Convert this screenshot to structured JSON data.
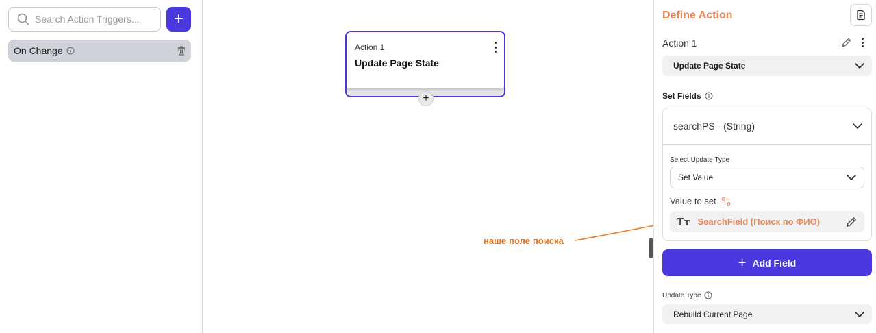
{
  "left_panel": {
    "search_placeholder": "Search Action Triggers...",
    "add_label": "+",
    "triggers": [
      {
        "label": "On Change"
      }
    ]
  },
  "canvas": {
    "action_card": {
      "label": "Action 1",
      "title": "Update Page State",
      "add_label": "+"
    },
    "annotation": {
      "words": [
        "наше",
        "поле",
        "поиска"
      ],
      "color": "#e8761f"
    }
  },
  "right_panel": {
    "title": "Define Action",
    "action_name": "Action 1",
    "action_type": "Update Page State",
    "set_fields_label": "Set Fields",
    "field": {
      "name": "searchPS - (String)",
      "select_update_type_label": "Select Update Type",
      "update_type_value": "Set Value",
      "value_to_set_label": "Value to set",
      "value_icon_text": "Tт",
      "value": "SearchField (Поиск по ФИО)"
    },
    "add_field_label": "Add Field",
    "update_type_label": "Update Type",
    "update_type_value": "Rebuild Current Page"
  },
  "colors": {
    "primary": "#4b39e0",
    "accent_orange": "#e8875a",
    "trigger_bg": "#cfd3d9"
  },
  "icons": [
    "search-icon",
    "plus-icon",
    "info-icon",
    "trash-icon",
    "kebab-icon",
    "document-icon",
    "pencil-icon",
    "chevron-down-icon",
    "variable-icon",
    "text-type-icon"
  ]
}
